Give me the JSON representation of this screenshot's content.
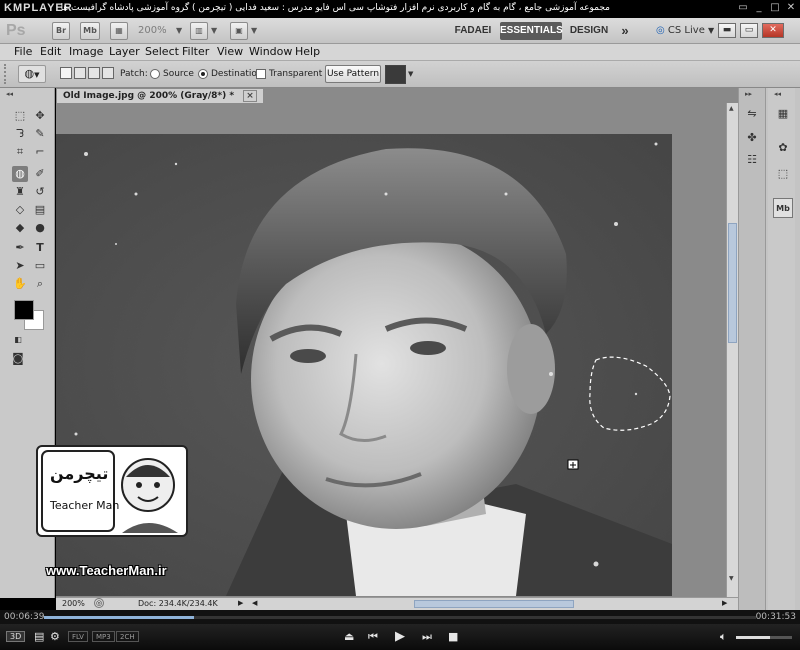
{
  "player": {
    "logo": "KMPLAYER",
    "caption": "مجموعه آموزشی جامع ، گام به گام و کاربردی نرم افزار فتوشاپ سی اس فایو مدرس : سعید فدایی ( تیچرمن ) گروه آموزشی پادشاه گرافیست ها",
    "time_elapsed": "00:06:39",
    "time_total": "00:31:53",
    "progress_fraction": 0.21,
    "volume_fraction": 0.6,
    "badges": [
      "3D",
      "FLV",
      "MP3",
      "2CH"
    ]
  },
  "appbar": {
    "logo": "Ps",
    "bridge": "Br",
    "minibridge": "Mb",
    "zoom": "200%",
    "workspaces": [
      "FADAEI",
      "ESSENTIALS",
      "DESIGN"
    ],
    "more": "»",
    "cslive": "CS Live"
  },
  "menu": [
    "File",
    "Edit",
    "Image",
    "Layer",
    "Select",
    "Filter",
    "View",
    "Window",
    "Help"
  ],
  "options": {
    "patch_label": "Patch:",
    "source_label": "Source",
    "destination_label": "Destination",
    "transparent_label": "Transparent",
    "use_pattern_label": "Use Pattern",
    "selected_mode": "Destination"
  },
  "document": {
    "tab_title": "Old Image.jpg @ 200% (Gray/8*) *",
    "close_glyph": "×",
    "status_zoom": "200%",
    "status_doc": "Doc: 234.4K/234.4K"
  },
  "watermark": {
    "brand": "Teacher Man",
    "persian": "تیچرمن",
    "url": "www.TeacherMan.ir"
  },
  "colors": {
    "foreground": "#000000",
    "background": "#ffffff",
    "workspace_active": "#5a5a5a"
  }
}
